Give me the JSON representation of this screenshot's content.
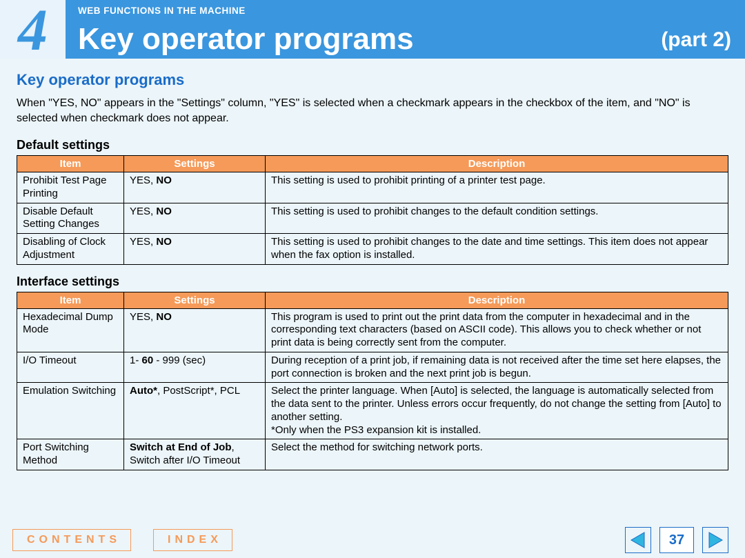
{
  "banner": {
    "chapter_number": "4",
    "kicker": "WEB FUNCTIONS IN THE MACHINE",
    "title": "Key operator programs",
    "part": "(part 2)"
  },
  "section_title": "Key operator programs",
  "intro": "When \"YES, NO\" appears in the \"Settings\" column, \"YES\" is selected when a checkmark appears in the checkbox of the item, and \"NO\" is selected when checkmark does not appear.",
  "table_headers": {
    "item": "Item",
    "settings": "Settings",
    "description": "Description"
  },
  "default_settings": {
    "heading": "Default settings",
    "rows": [
      {
        "item": "Prohibit Test Page Printing",
        "settings_html": "YES, <b>NO</b>",
        "description_html": "This setting is used to prohibit printing of a printer test page."
      },
      {
        "item": "Disable Default Setting Changes",
        "settings_html": "YES, <b>NO</b>",
        "description_html": "This setting is used to prohibit changes to the default condition settings."
      },
      {
        "item": "Disabling of Clock Adjustment",
        "settings_html": "YES, <b>NO</b>",
        "description_html": "This setting is used to prohibit changes to the date and time settings. This item does not appear when the fax option is installed."
      }
    ]
  },
  "interface_settings": {
    "heading": "Interface settings",
    "rows": [
      {
        "item": "Hexadecimal Dump Mode",
        "settings_html": "YES, <b>NO</b>",
        "description_html": "This program is used to print out the print data from the computer in hexadecimal and in the corresponding text characters (based on ASCII code). This allows you to check whether or not print data is being correctly sent from the computer."
      },
      {
        "item": "I/O Timeout",
        "settings_html": "1- <b>60</b> - 999 (sec)",
        "description_html": "During reception of a print job, if remaining data is not received after the time set here elapses, the port connection is broken and the next print job is begun."
      },
      {
        "item": "Emulation Switching",
        "settings_html": "<b>Auto*</b>, PostScript*, PCL",
        "description_html": "Select the printer language. When [Auto] is selected, the language is automatically selected from the data sent to the printer. Unless errors occur frequently, do not change the setting from [Auto] to another setting.<br>*Only when the PS3 expansion kit is installed."
      },
      {
        "item": "Port Switching Method",
        "settings_html": "<b>Switch at End of Job</b>, Switch after I/O Timeout",
        "description_html": "Select the method for switching network ports."
      }
    ]
  },
  "footer": {
    "contents": "CONTENTS",
    "index": "INDEX",
    "page_number": "37"
  }
}
